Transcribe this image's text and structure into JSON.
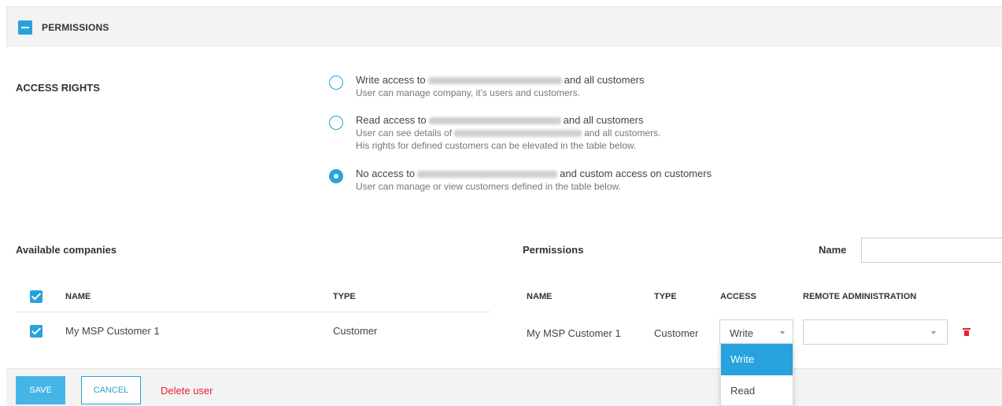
{
  "panel": {
    "title": "PERMISSIONS"
  },
  "access_rights": {
    "label": "ACCESS RIGHTS",
    "options": [
      {
        "prefix": "Write access to",
        "suffix": "and all customers",
        "desc1": "User can manage company, it's users and customers.",
        "checked": false
      },
      {
        "prefix": "Read access to",
        "suffix": "and all customers",
        "desc1_prefix": "User can see details of",
        "desc1_suffix": "and all customers.",
        "desc2": "His rights for defined customers can be elevated in the table below.",
        "checked": false
      },
      {
        "prefix": "No access to",
        "suffix": "and custom access on customers",
        "desc1": "User can manage or view customers defined in the table below.",
        "checked": true
      }
    ]
  },
  "available": {
    "label": "Available companies",
    "columns": {
      "name": "NAME",
      "type": "TYPE"
    },
    "rows": [
      {
        "name": "My MSP Customer 1",
        "type": "Customer",
        "checked": true
      }
    ]
  },
  "permissions": {
    "label": "Permissions",
    "filter_label": "Name",
    "filter_value": "",
    "columns": {
      "name": "NAME",
      "type": "TYPE",
      "access": "ACCESS",
      "remote": "REMOTE ADMINISTRATION"
    },
    "rows": [
      {
        "name": "My MSP Customer 1",
        "type": "Customer",
        "access": "Write",
        "remote": ""
      }
    ],
    "access_options": [
      "Write",
      "Read"
    ]
  },
  "footer": {
    "save": "SAVE",
    "cancel": "CANCEL",
    "delete": "Delete user"
  },
  "colors": {
    "accent": "#27a2dc",
    "danger": "#e8202f"
  }
}
